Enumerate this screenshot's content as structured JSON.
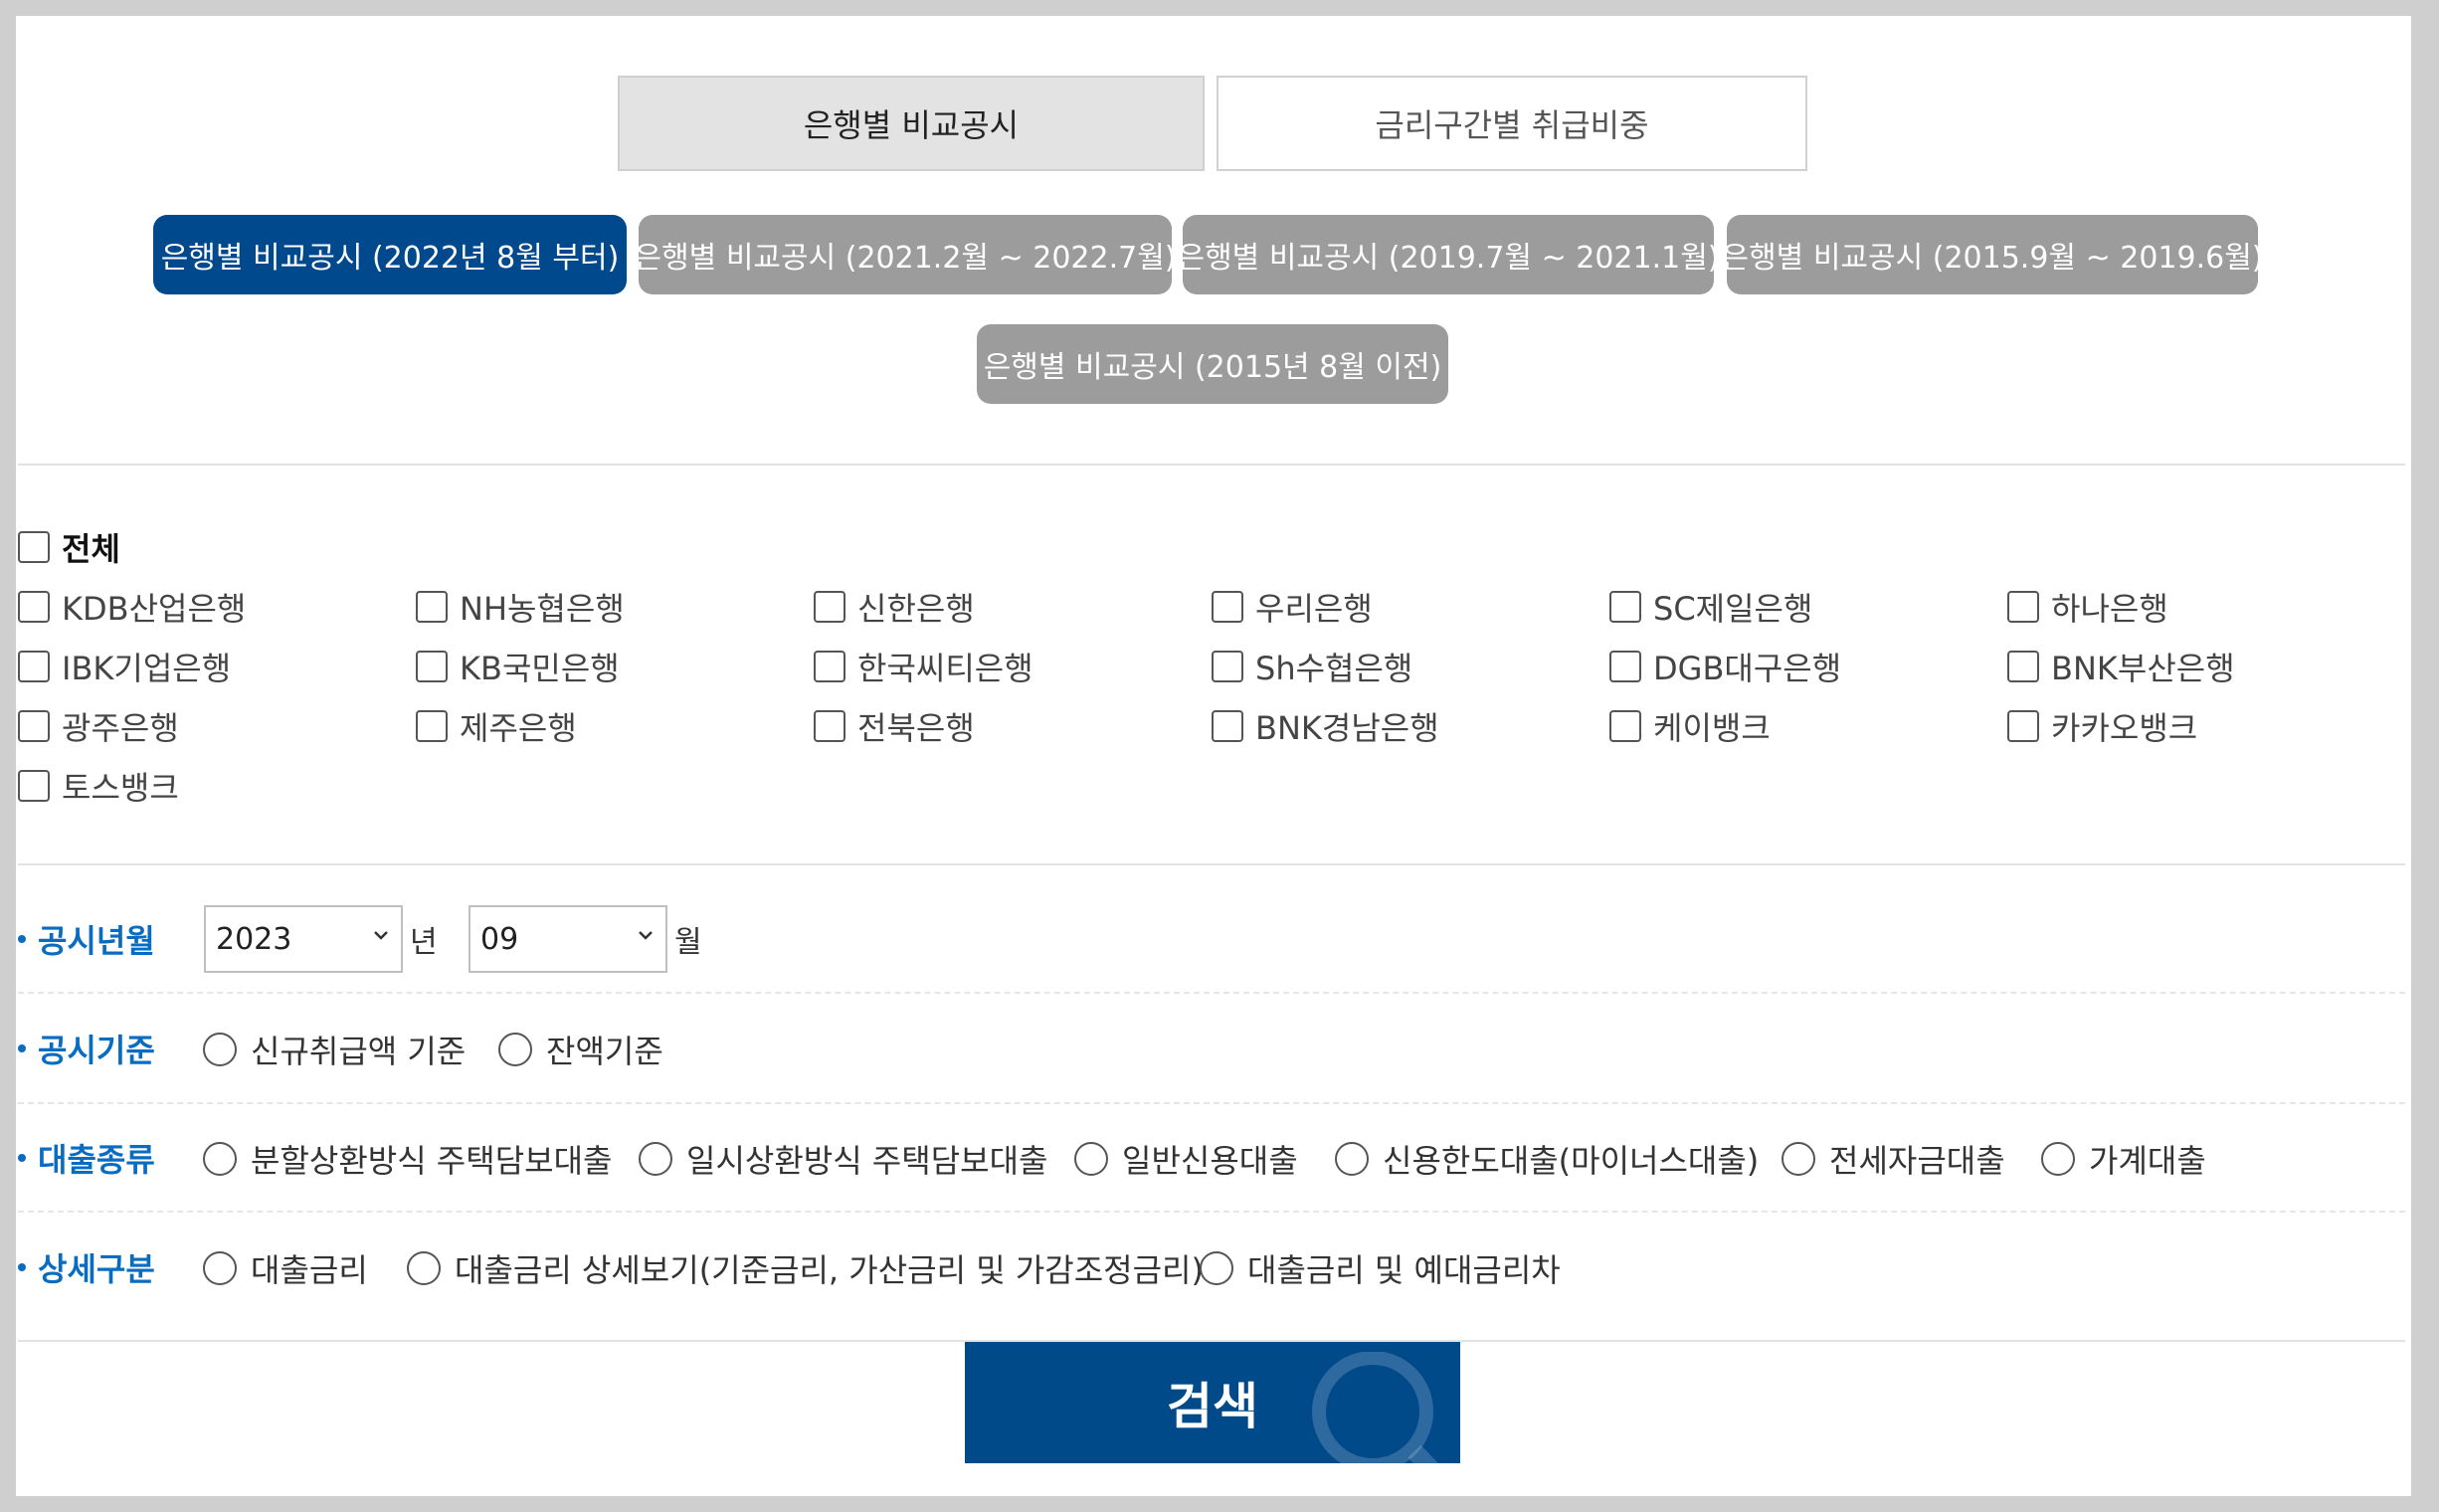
{
  "tabs": [
    {
      "label": "은행별 비교공시",
      "active": true
    },
    {
      "label": "금리구간별 취급비중",
      "active": false
    }
  ],
  "periods": [
    {
      "label": "은행별 비교공시 (2022년 8월 부터)",
      "active": true
    },
    {
      "label": "은행별 비교공시 (2021.2월 ~ 2022.7월)",
      "active": false
    },
    {
      "label": "은행별 비교공시 (2019.7월 ~ 2021.1월)",
      "active": false
    },
    {
      "label": "은행별 비교공시 (2015.9월 ~ 2019.6월)",
      "active": false
    },
    {
      "label": "은행별 비교공시 (2015년 8월 이전)",
      "active": false
    }
  ],
  "banks": {
    "all_label": "전체",
    "items": [
      "KDB산업은행",
      "NH농협은행",
      "신한은행",
      "우리은행",
      "SC제일은행",
      "하나은행",
      "IBK기업은행",
      "KB국민은행",
      "한국씨티은행",
      "Sh수협은행",
      "DGB대구은행",
      "BNK부산은행",
      "광주은행",
      "제주은행",
      "전북은행",
      "BNK경남은행",
      "케이뱅크",
      "카카오뱅크",
      "토스뱅크"
    ]
  },
  "filters": {
    "period": {
      "label": "공시년월",
      "year": "2023",
      "year_unit": "년",
      "month": "09",
      "month_unit": "월"
    },
    "basis": {
      "label": "공시기준",
      "options": [
        "신규취급액 기준",
        "잔액기준"
      ]
    },
    "loan_type": {
      "label": "대출종류",
      "options": [
        "분할상환방식 주택담보대출",
        "일시상환방식 주택담보대출",
        "일반신용대출",
        "신용한도대출(마이너스대출)",
        "전세자금대출",
        "가계대출"
      ]
    },
    "detail": {
      "label": "상세구분",
      "options": [
        "대출금리",
        "대출금리 상세보기(기준금리, 가산금리 및 가감조정금리)",
        "대출금리 및 예대금리차"
      ]
    }
  },
  "search_label": "검색",
  "colors": {
    "primary": "#00498c",
    "accent_text": "#0a6cc0",
    "inactive_pill": "#9c9c9c"
  }
}
